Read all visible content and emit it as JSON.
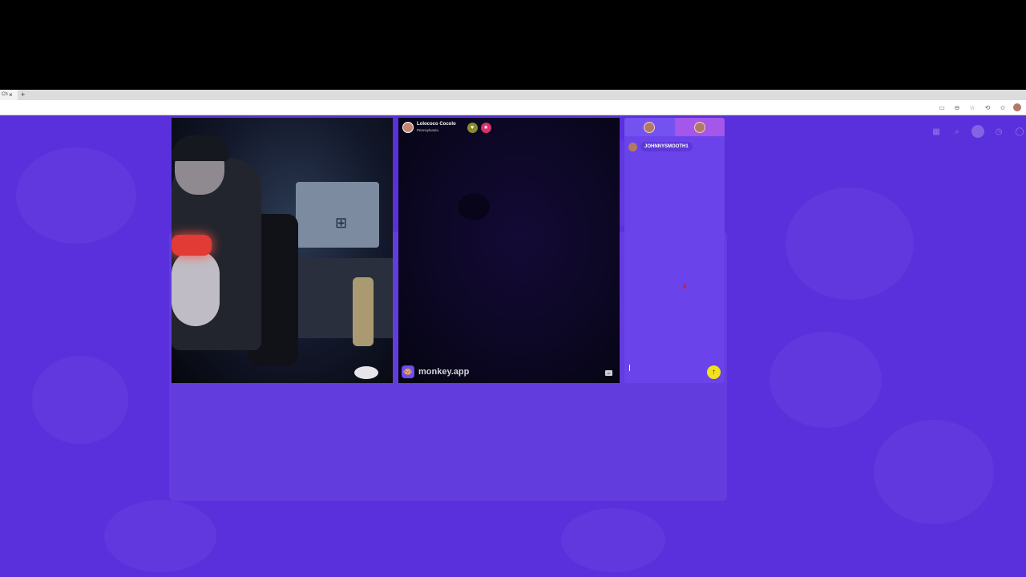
{
  "browser": {
    "tab_title": "Ch",
    "tab_close": "×",
    "new_tab": "+",
    "toolbar_icons": [
      {
        "name": "cast-icon",
        "glyph": "▭"
      },
      {
        "name": "zoom-icon",
        "glyph": "⊖"
      },
      {
        "name": "bookmark-star-icon",
        "glyph": "☆"
      },
      {
        "name": "extensions-icon",
        "glyph": "⟲"
      },
      {
        "name": "favorites-icon",
        "glyph": "✩"
      }
    ]
  },
  "page": {
    "background_color": "#5a30dc",
    "nav_icons": [
      {
        "name": "shop-icon",
        "glyph": "▦"
      },
      {
        "name": "search-icon",
        "glyph": "⌕"
      },
      {
        "name": "history-icon",
        "glyph": "◷"
      },
      {
        "name": "chat-bubble-icon",
        "glyph": "◯"
      }
    ]
  },
  "partner": {
    "name": "Lolococo Cocolo",
    "location": "Pennsylvania",
    "react_glyph": "♥",
    "star_glyph": "★"
  },
  "brand": {
    "logo_glyph": "🐵",
    "text": "monkey.app",
    "cc_glyph": "cc"
  },
  "chat": {
    "messages": [
      {
        "author": "partner",
        "text": "JOHNNYSMOOTH1"
      }
    ],
    "input_value": "",
    "send_glyph": "↑"
  },
  "colors": {
    "accent": "#f2e21a",
    "chat_panel": "#6a44ea",
    "star_button": "#d8306a"
  }
}
